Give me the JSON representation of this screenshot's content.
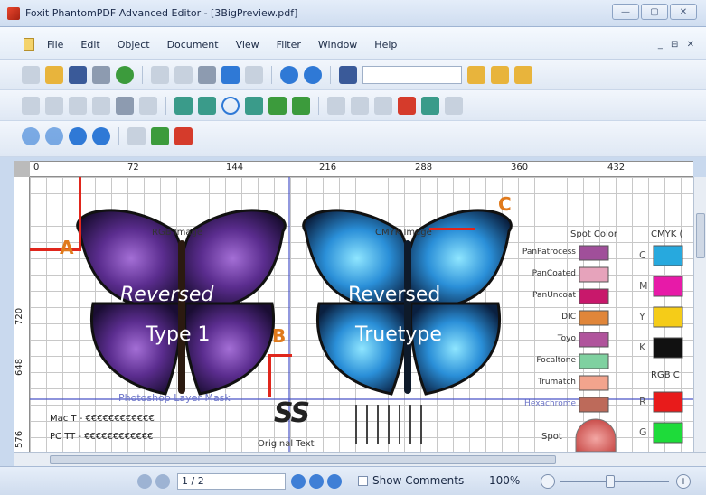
{
  "window": {
    "title": "Foxit PhantomPDF Advanced Editor - [3BigPreview.pdf]",
    "btn_min": "—",
    "btn_max": "▢",
    "btn_close": "✕"
  },
  "menubar": {
    "items": [
      "File",
      "Edit",
      "Object",
      "Document",
      "View",
      "Filter",
      "Window",
      "Help"
    ],
    "mdi_controls": "_ ⊟ ✕"
  },
  "ruler": {
    "h_ticks": [
      "0",
      "72",
      "144",
      "216",
      "288",
      "360",
      "432"
    ],
    "v_ticks": [
      "720",
      "648",
      "576"
    ]
  },
  "document": {
    "rgb_label": "RGB Image",
    "cmyk_label": "CMYK Image",
    "butterfly1_line1": "Reversed",
    "butterfly1_line2": "Type 1",
    "butterfly2_line1": "Reversed",
    "butterfly2_line2": "Truetype",
    "layer_mask": "Photoshop Layer Mask",
    "spot_color_header": "Spot Color",
    "cmyk_header": "CMYK (",
    "rgb_header": "RGB C",
    "spot_colors": [
      {
        "name": "PanPatrocess",
        "color": "#a04f9a"
      },
      {
        "name": "PanCoated",
        "color": "#e6a3bb"
      },
      {
        "name": "PanUncoat",
        "color": "#c8186b"
      },
      {
        "name": "DIC",
        "color": "#e0863a"
      },
      {
        "name": "Toyo",
        "color": "#b0549c"
      },
      {
        "name": "Focaltone",
        "color": "#7fd1a0"
      },
      {
        "name": "Trumatch",
        "color": "#f2a48d"
      },
      {
        "name": "Hexachrome",
        "color": "#bd6a5a"
      }
    ],
    "cmyk_swatches": [
      {
        "letter": "C",
        "color": "#27a9de"
      },
      {
        "letter": "M",
        "color": "#e71aa8"
      },
      {
        "letter": "Y",
        "color": "#f5cc18"
      },
      {
        "letter": "K",
        "color": "#111111"
      }
    ],
    "rgb_swatches": [
      {
        "letter": "R",
        "color": "#e81b1b"
      },
      {
        "letter": "G",
        "color": "#1edb3a"
      }
    ],
    "mac_text": "Mac T - €€€€€€€€€€€€",
    "pc_text": "PC TT - €€€€€€€€€€€€",
    "ss_logo": "SS",
    "original_text": "Original Text",
    "spot_bottom": "Spot"
  },
  "annotations": {
    "a": "A",
    "b": "B",
    "c": "C"
  },
  "status": {
    "page": "1 / 2",
    "show_comments": "Show Comments",
    "zoom": "100%",
    "zoom_minus": "−",
    "zoom_plus": "+"
  }
}
